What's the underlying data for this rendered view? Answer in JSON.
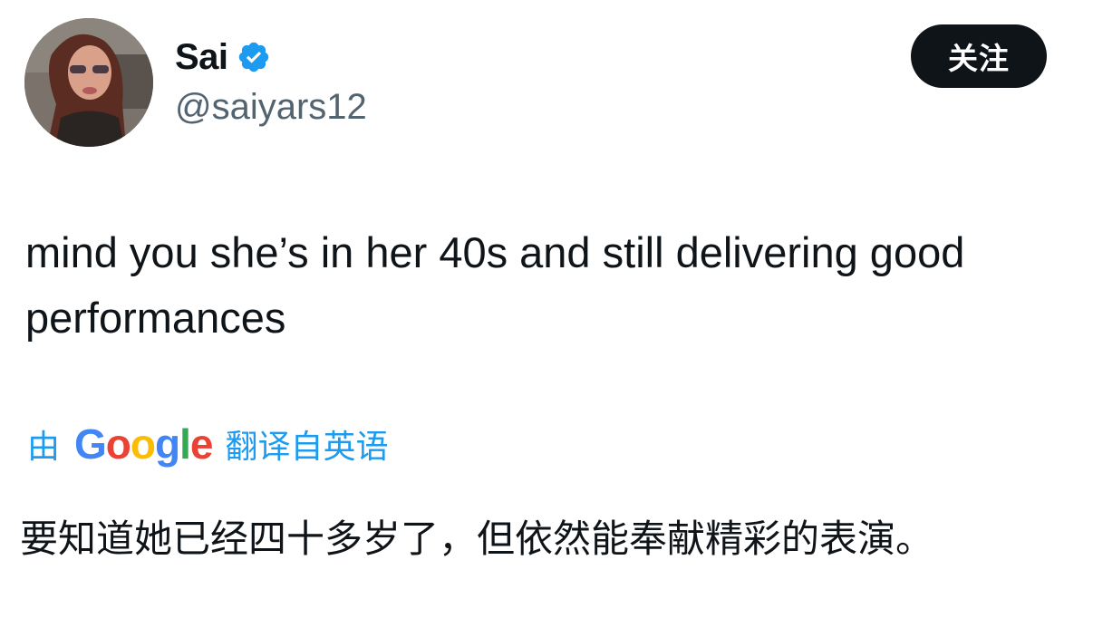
{
  "author": {
    "display_name": "Sai",
    "handle": "@saiyars12",
    "verified": true
  },
  "follow_button": {
    "label": "关注"
  },
  "tweet": {
    "text": "mind you she’s in her 40s and still delivering good performances"
  },
  "translation": {
    "prefix": "由",
    "provider": "Google",
    "suffix": "翻译自英语",
    "text": "要知道她已经四十多岁了，但依然能奉献精彩的表演。"
  },
  "icons": {
    "verified": "verified-badge-icon"
  },
  "colors": {
    "text": "#0f1419",
    "secondary_text": "#536471",
    "accent_blue": "#1d9bf0",
    "button_bg": "#0f1419",
    "button_text": "#ffffff"
  }
}
